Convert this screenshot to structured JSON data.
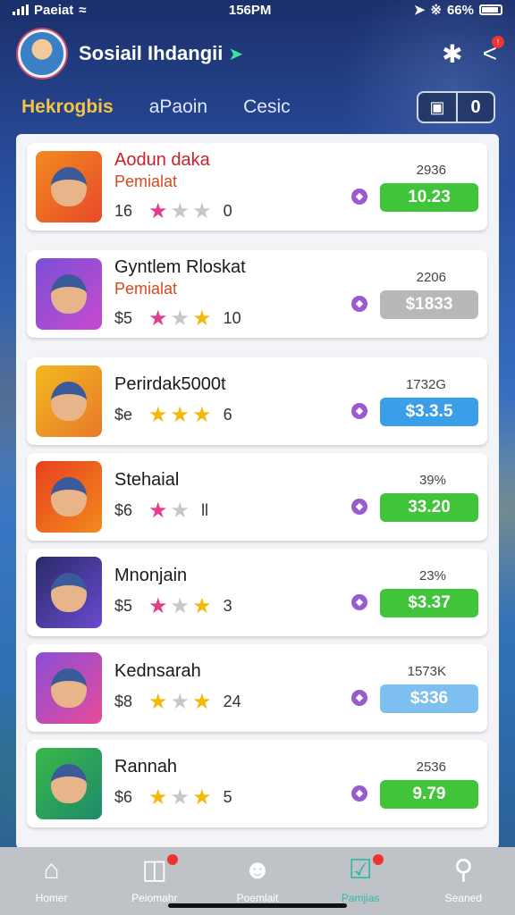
{
  "status_bar": {
    "carrier": "Paeiat",
    "time": "156PM",
    "battery": "66%"
  },
  "header": {
    "profile_name": "Sosiail Ihdangii",
    "tabs": [
      {
        "label": "Hekrogbis",
        "active": true
      },
      {
        "label": "aPaoin",
        "active": false
      },
      {
        "label": "Cesic",
        "active": false
      }
    ],
    "coin_icon": "save-icon",
    "coin_count": "0"
  },
  "items": [
    {
      "title": "Aodun daka",
      "subtitle": "Pemialat",
      "count": "16",
      "stars": [
        "pink",
        "gray",
        "gray"
      ],
      "reviews": "0",
      "small_value": "2936",
      "price": "10.23",
      "price_color": "green"
    },
    {
      "title": "Gyntlem Rloskat",
      "subtitle": "Pemialat",
      "count": "$5",
      "stars": [
        "pink",
        "gray",
        "gold"
      ],
      "reviews": "10",
      "small_value": "2206",
      "price": "$1833",
      "price_color": "gray"
    },
    {
      "title": "Perirdak5000t",
      "subtitle": "",
      "count": "$e",
      "stars": [
        "gold",
        "gold",
        "gold"
      ],
      "reviews": "6",
      "small_value": "1732G",
      "price": "$3.3.5",
      "price_color": "blue"
    },
    {
      "title": "Stehaial",
      "subtitle": "",
      "count": "$6",
      "stars": [
        "pink",
        "gray"
      ],
      "reviews": "ll",
      "small_value": "39%",
      "price": "33.20",
      "price_color": "green"
    },
    {
      "title": "Mnonjain",
      "subtitle": "",
      "count": "$5",
      "stars": [
        "pink",
        "gray",
        "gold"
      ],
      "reviews": "3",
      "small_value": "23%",
      "price": "$3.37",
      "price_color": "green"
    },
    {
      "title": "Kednsarah",
      "subtitle": "",
      "count": "$8",
      "stars": [
        "gold",
        "gray",
        "gold"
      ],
      "reviews": "24",
      "small_value": "1573K",
      "price": "$336",
      "price_color": "lightblue"
    },
    {
      "title": "Rannah",
      "subtitle": "",
      "count": "$6",
      "stars": [
        "gold",
        "gray",
        "gold"
      ],
      "reviews": "5",
      "small_value": "2536",
      "price": "9.79",
      "price_color": "green"
    }
  ],
  "bottom_nav": [
    {
      "label": "Homer",
      "icon": "home-icon",
      "active": false,
      "notif": false
    },
    {
      "label": "Peiomahr",
      "icon": "bag-icon",
      "active": false,
      "notif": true
    },
    {
      "label": "Poemlait",
      "icon": "avatar-icon",
      "active": false,
      "notif": false
    },
    {
      "label": "Pamjias",
      "icon": "clipboard-icon",
      "active": true,
      "notif": true
    },
    {
      "label": "Seaned",
      "icon": "search-icon",
      "active": false,
      "notif": false
    }
  ]
}
